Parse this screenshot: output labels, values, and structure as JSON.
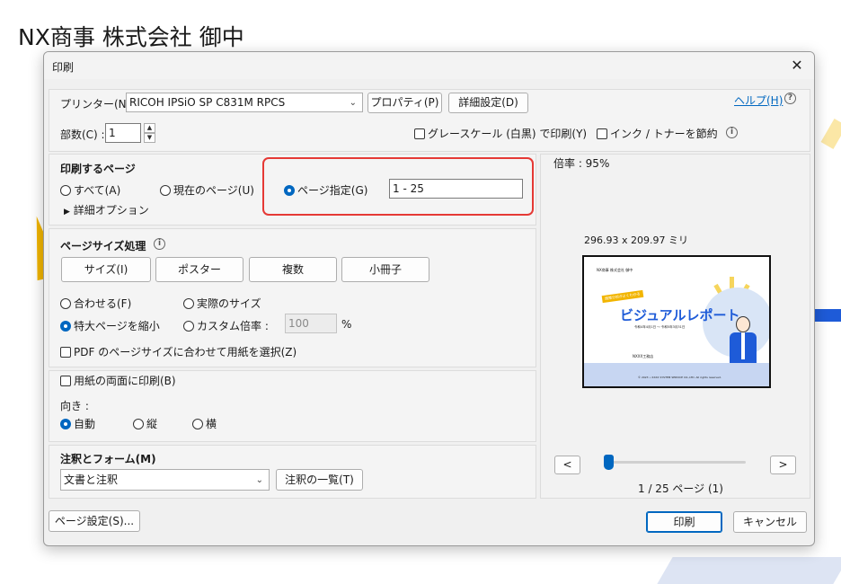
{
  "background": {
    "title": "NX商事  株式会社    御中"
  },
  "dialog": {
    "title": "印刷",
    "close": "✕"
  },
  "printer": {
    "label": "プリンター(N) :",
    "value": "RICOH IPSiO SP C831M RPCS",
    "properties_button": "プロパティ(P)",
    "advanced_button": "詳細設定(D)",
    "help_link": "ヘルプ(H)",
    "copies_label": "部数(C) :",
    "copies_value": "1",
    "grayscale_label": "グレースケール (白黒) で印刷(Y)",
    "save_ink_label": "インク / トナーを節約"
  },
  "pages": {
    "heading": "印刷するページ",
    "all": "すべて(A)",
    "current": "現在のページ(U)",
    "range": "ページ指定(G)",
    "range_value": "1 - 25",
    "more_options": "詳細オプション"
  },
  "sizing": {
    "heading": "ページサイズ処理",
    "tabs": [
      "サイズ(I)",
      "ポスター",
      "複数",
      "小冊子"
    ],
    "fit": "合わせる(F)",
    "actual": "実際のサイズ",
    "shrink": "特大ページを縮小",
    "custom": "カスタム倍率 :",
    "custom_value": "100",
    "percent": "%",
    "pdf_paper": "PDF のページサイズに合わせて用紙を選択(Z)"
  },
  "duplex": {
    "both_sides": "用紙の両面に印刷(B)",
    "orientation_label": "向き :",
    "auto": "自動",
    "portrait": "縦",
    "landscape": "横"
  },
  "comments": {
    "heading": "注釈とフォーム(M)",
    "value": "文書と注釈",
    "summary_button": "注釈の一覧(T)"
  },
  "preview": {
    "scale": "倍率 : 95%",
    "dimensions": "296.93 x 209.97 ミリ",
    "page_header": "NX商事 株式会社 御中",
    "page_badge": "施策分析がよくわかる",
    "page_title": "ビジュアルレポート",
    "page_period": "令和4年4月1日 〜 令和5年3月31日",
    "page_company": "NXXX工務店",
    "page_footer": "© 2023 • XXXX SYSTEM SERVICE CO.,LTD. All rights reserved.",
    "prev": "<",
    "next": ">",
    "page_count": "1 / 25 ページ (1)"
  },
  "footer": {
    "page_setup": "ページ設定(S)...",
    "print": "印刷",
    "cancel": "キャンセル"
  },
  "colors": {
    "accent": "#0067c0",
    "highlight": "#e53935"
  }
}
